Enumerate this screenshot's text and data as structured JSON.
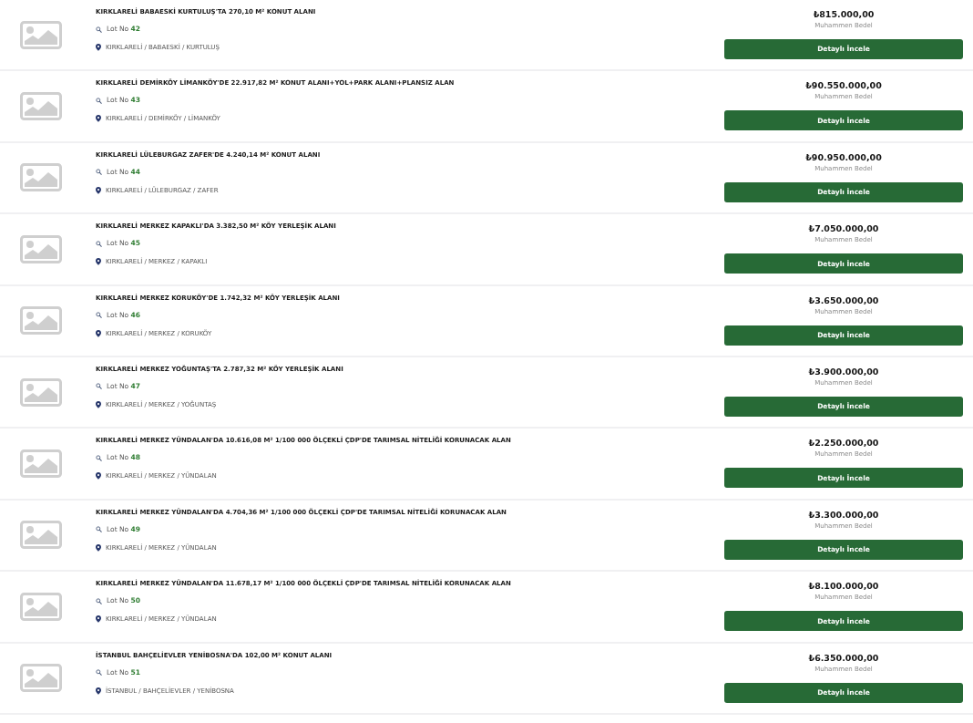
{
  "listings": [
    {
      "title": "KIRKLARELİ BABAESKİ KURTULUŞ'TA 270,10 M² KONUT ALANI",
      "lot_label": "Lot No",
      "lot_number": "42",
      "location": "KIRKLARELİ / BABAESKİ / KURTULUŞ",
      "price": "₺815.000,00",
      "price_label": "Muhammen Bedel",
      "button": "Detaylı İncele"
    },
    {
      "title": "KIRKLARELİ DEMİRKÖY LİMANKÖY'DE 22.917,82 M² KONUT ALANI+YOL+PARK ALANI+PLANSIZ ALAN",
      "lot_label": "Lot No",
      "lot_number": "43",
      "location": "KIRKLARELİ / DEMİRKÖY / LİMANKÖY",
      "price": "₺90.550.000,00",
      "price_label": "Muhammen Bedel",
      "button": "Detaylı İncele"
    },
    {
      "title": "KIRKLARELİ LÜLEBURGAZ ZAFER'DE 4.240,14 M² KONUT ALANI",
      "lot_label": "Lot No",
      "lot_number": "44",
      "location": "KIRKLARELİ / LÜLEBURGAZ / ZAFER",
      "price": "₺90.950.000,00",
      "price_label": "Muhammen Bedel",
      "button": "Detaylı İncele"
    },
    {
      "title": "KIRKLARELİ MERKEZ KAPAKLI'DA 3.382,50 M² KÖY YERLEŞİK ALANI",
      "lot_label": "Lot No",
      "lot_number": "45",
      "location": "KIRKLARELİ / MERKEZ / KAPAKLI",
      "price": "₺7.050.000,00",
      "price_label": "Muhammen Bedel",
      "button": "Detaylı İncele"
    },
    {
      "title": "KIRKLARELİ MERKEZ KORUKÖY'DE 1.742,32 M² KÖY YERLEŞİK ALANI",
      "lot_label": "Lot No",
      "lot_number": "46",
      "location": "KIRKLARELİ / MERKEZ / KORUKÖY",
      "price": "₺3.650.000,00",
      "price_label": "Muhammen Bedel",
      "button": "Detaylı İncele"
    },
    {
      "title": "KIRKLARELİ MERKEZ YOĞUNTAŞ'TA 2.787,32 M² KÖY YERLEŞİK ALANI",
      "lot_label": "Lot No",
      "lot_number": "47",
      "location": "KIRKLARELİ / MERKEZ / YOĞUNTAŞ",
      "price": "₺3.900.000,00",
      "price_label": "Muhammen Bedel",
      "button": "Detaylı İncele"
    },
    {
      "title": "KIRKLARELİ MERKEZ YÜNDALAN'DA 10.616,08 M² 1/100 000 ÖLÇEKLİ ÇDP'DE TARIMSAL NİTELİĞİ KORUNACAK ALAN",
      "lot_label": "Lot No",
      "lot_number": "48",
      "location": "KIRKLARELİ / MERKEZ / YÜNDALAN",
      "price": "₺2.250.000,00",
      "price_label": "Muhammen Bedel",
      "button": "Detaylı İncele"
    },
    {
      "title": "KIRKLARELİ MERKEZ YÜNDALAN'DA 4.704,36 M² 1/100 000 ÖLÇEKLİ ÇDP'DE TARIMSAL NİTELİĞİ KORUNACAK ALAN",
      "lot_label": "Lot No",
      "lot_number": "49",
      "location": "KIRKLARELİ / MERKEZ / YÜNDALAN",
      "price": "₺3.300.000,00",
      "price_label": "Muhammen Bedel",
      "button": "Detaylı İncele"
    },
    {
      "title": "KIRKLARELİ MERKEZ YÜNDALAN'DA 11.678,17 M² 1/100 000 ÖLÇEKLİ ÇDP'DE TARIMSAL NİTELİĞİ KORUNACAK ALAN",
      "lot_label": "Lot No",
      "lot_number": "50",
      "location": "KIRKLARELİ / MERKEZ / YÜNDALAN",
      "price": "₺8.100.000,00",
      "price_label": "Muhammen Bedel",
      "button": "Detaylı İncele"
    },
    {
      "title": "İSTANBUL BAHÇELİEVLER YENİBOSNA'DA 102,00 M² KONUT ALANI",
      "lot_label": "Lot No",
      "lot_number": "51",
      "location": "İSTANBUL / BAHÇELİEVLER / YENİBOSNA",
      "price": "₺6.350.000,00",
      "price_label": "Muhammen Bedel",
      "button": "Detaylı İncele"
    }
  ]
}
